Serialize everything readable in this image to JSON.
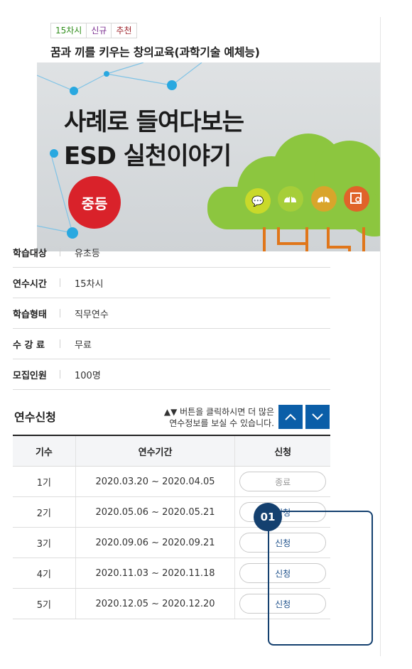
{
  "badges": {
    "hours": "15차시",
    "new": "신규",
    "recommended": "추천"
  },
  "course_title": "꿈과 끼를 키우는 창의교육(과학기술 예체능)",
  "banner": {
    "line1": "사례로 들여다보는",
    "line2": "ESD 실천이야기",
    "level": "중등"
  },
  "info": [
    {
      "label": "학습대상",
      "value": "유초등"
    },
    {
      "label": "연수시간",
      "value": "15차시"
    },
    {
      "label": "학습형태",
      "value": "직무연수"
    },
    {
      "label": "수 강 료",
      "value": "무료"
    },
    {
      "label": "모집인원",
      "value": "100명"
    }
  ],
  "apply": {
    "title": "연수신청",
    "hint_line1": "▲▼ 버튼을 클릭하시면 더 많은",
    "hint_line2": "연수정보를 보실 수 있습니다."
  },
  "table": {
    "headers": [
      "기수",
      "연수기간",
      "신청"
    ],
    "rows": [
      {
        "term": "1기",
        "period": "2020.03.20 ~ 2020.04.05",
        "action": "종료"
      },
      {
        "term": "2기",
        "period": "2020.05.06 ~ 2020.05.21",
        "action": "신청"
      },
      {
        "term": "3기",
        "period": "2020.09.06 ~ 2020.09.21",
        "action": "신청"
      },
      {
        "term": "4기",
        "period": "2020.11.03 ~ 2020.11.18",
        "action": "신청"
      },
      {
        "term": "5기",
        "period": "2020.12.05 ~ 2020.12.20",
        "action": "신청"
      }
    ]
  },
  "step_badge": "01",
  "colors": {
    "primary": "#0b5ea8",
    "highlight": "#14406f",
    "level_red": "#d9222a",
    "tree_green": "#8cc63f"
  },
  "icons": [
    "chevron-up-icon",
    "chevron-down-icon",
    "chat-icon",
    "cloud-upload-icon",
    "cloud-download-icon",
    "image-search-icon"
  ]
}
